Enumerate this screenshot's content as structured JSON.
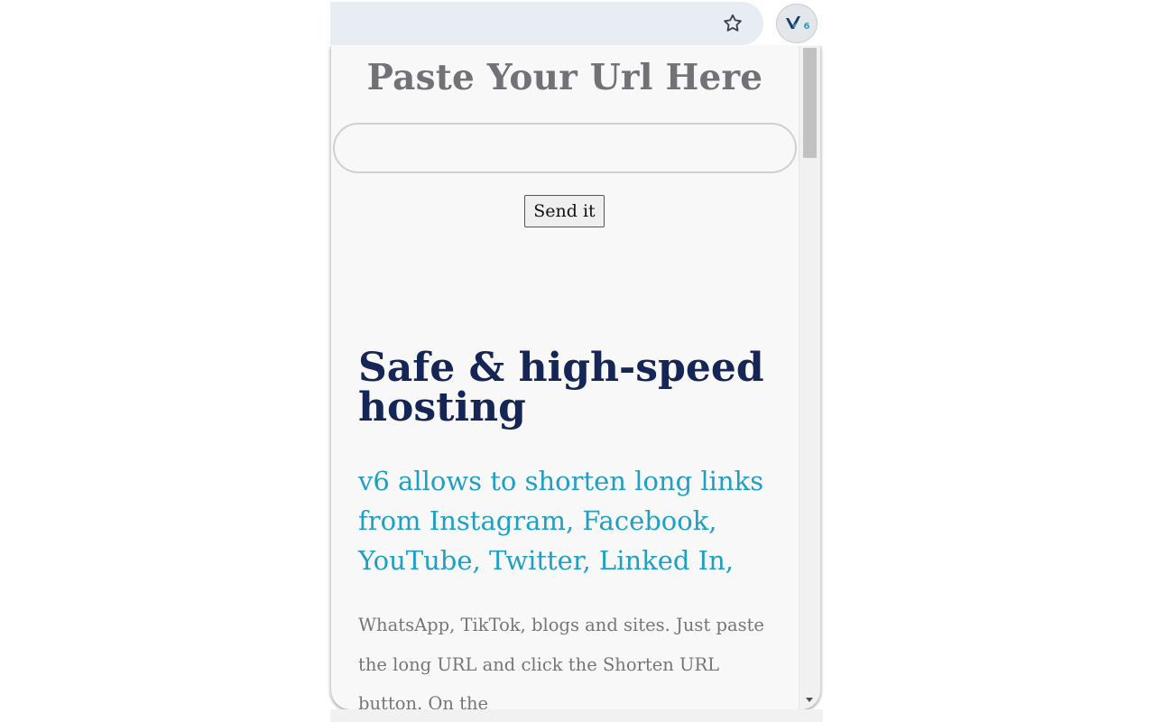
{
  "toolbar": {
    "bookmark_icon": "star-outline-icon",
    "extension_icon": "v6-logo-icon",
    "extension_logo_text": "6"
  },
  "popup": {
    "title": "Paste Your Url Here",
    "url_input": {
      "value": "",
      "placeholder": ""
    },
    "send_button_label": "Send it",
    "hero": {
      "heading": "Safe & high-speed hosting",
      "subheading": "v6 allows to shorten long links from Instagram, Facebook, YouTube, Twitter, Linked In,",
      "body": "WhatsApp, TikTok, blogs and sites. Just paste the long URL and click the Shorten URL button. On the"
    }
  },
  "colors": {
    "title": "#707277",
    "heading": "#152555",
    "accent": "#1f9fc4",
    "body_text": "#767676",
    "omnibox_bg": "#e8ecf3",
    "popup_bg": "#f8f8f9"
  }
}
